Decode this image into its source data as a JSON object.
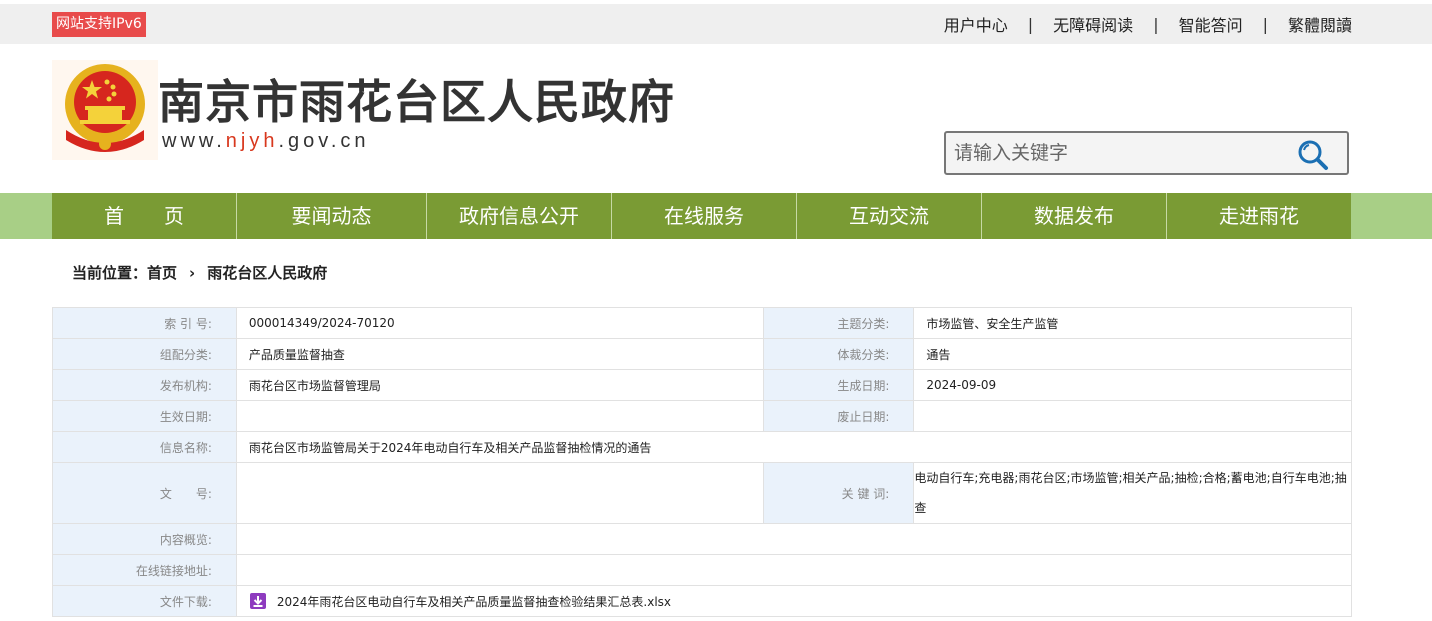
{
  "topbar": {
    "ipv6_badge": "网站支持IPv6",
    "links": [
      "用户中心",
      "无障碍阅读",
      "智能答问",
      "繁體閱讀"
    ],
    "separator": "|"
  },
  "header": {
    "title": "南京市雨花台区人民政府",
    "url_prefix": "www.",
    "url_highlight": "njyh",
    "url_suffix": ".gov.cn"
  },
  "search": {
    "placeholder": "请输入关键字"
  },
  "nav": {
    "items": [
      "首　　页",
      "要闻动态",
      "政府信息公开",
      "在线服务",
      "互动交流",
      "数据发布",
      "走进雨花"
    ]
  },
  "breadcrumb": {
    "prefix": "当前位置：",
    "home": "首页",
    "arrow": "›",
    "current": "雨花台区人民政府"
  },
  "meta": {
    "index_no_label": "索 引 号:",
    "index_no": "000014349/2024-70120",
    "topic_label": "主题分类:",
    "topic": "市场监管、安全生产监管",
    "category_label": "组配分类:",
    "category": "产品质量监督抽查",
    "genre_label": "体裁分类:",
    "genre": "通告",
    "publisher_label": "发布机构:",
    "publisher": "雨花台区市场监督管理局",
    "created_label": "生成日期:",
    "created": "2024-09-09",
    "effective_label": "生效日期:",
    "effective": "",
    "expired_label": "废止日期:",
    "expired": "",
    "name_label": "信息名称:",
    "name": "雨花台区市场监管局关于2024年电动自行车及相关产品监督抽检情况的通告",
    "doc_no_label": "文　　号:",
    "doc_no": "",
    "keywords_label": "关 键 词:",
    "keywords": "电动自行车;充电器;雨花台区;市场监管;相关产品;抽检;合格;蓄电池;自行车电池;抽查",
    "summary_label": "内容概览:",
    "summary": "",
    "link_label": "在线链接地址:",
    "link": "",
    "download_label": "文件下载:",
    "download_file": "2024年雨花台区电动自行车及相关产品质量监督抽查检验结果汇总表.xlsx"
  },
  "colors": {
    "nav_bg": "#7a9b34",
    "nav_outer": "#a8cf86",
    "ipv6_badge": "#e84b4b",
    "label_cell": "#eaf2fb"
  }
}
